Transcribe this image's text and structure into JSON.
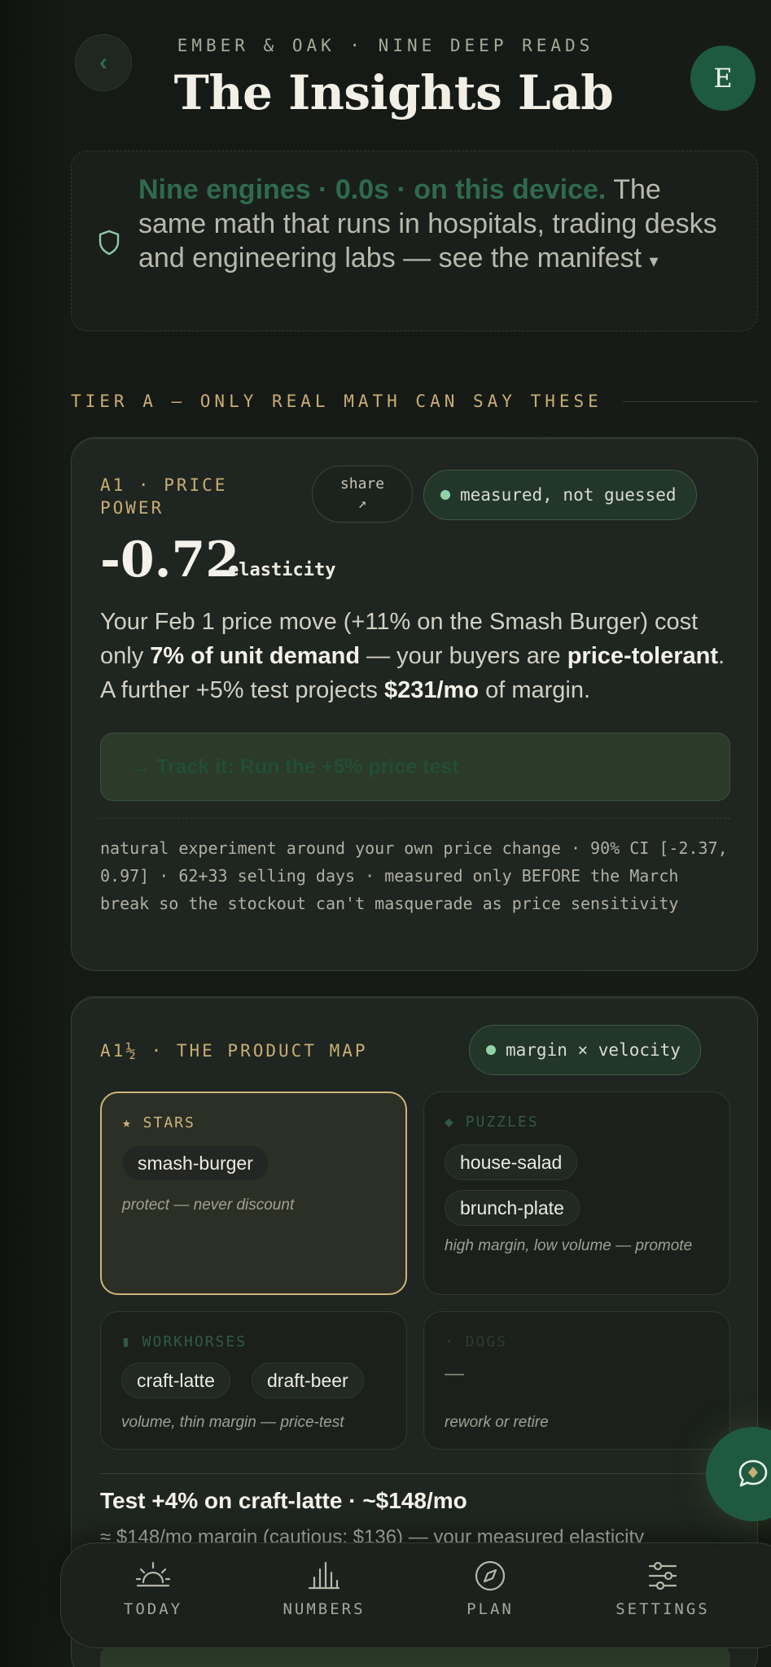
{
  "header": {
    "eyebrow": "EMBER & OAK · NINE DEEP READS",
    "title": "The Insights Lab",
    "back_icon": "chevron-left-icon",
    "avatar_initial": "E"
  },
  "manifest": {
    "highlight": "Nine engines · 0.0s · on this device.",
    "rest": " The same math that runs in hospitals, trading desks and engineering labs — see the manifest",
    "caret": "▾",
    "icon": "shield-icon"
  },
  "tier": {
    "label": "TIER A — ONLY REAL MATH CAN SAY THESE"
  },
  "price_power": {
    "tag_line1": "A1 · PRICE",
    "tag_line2": "POWER",
    "share_label": "share",
    "share_glyph": "↗",
    "badge": "measured, not guessed",
    "value": "-0.72",
    "unit": "elasticity",
    "body": {
      "p1": "Your Feb 1 price move (+11% on the Smash Burger) cost only ",
      "b1": "7% of unit demand",
      "p2": " — your buyers are ",
      "b2": "price-tolerant",
      "p3": ". A further +5% test projects ",
      "b3": "$231/mo",
      "p4": " of margin."
    },
    "cta_label": "→ Track it: Run the +5% price test",
    "fine_print": "natural experiment around your own price change · 90% CI [-2.37, 0.97] · 62+33 selling days · measured only BEFORE the March break so the stockout can't masquerade as price sensitivity"
  },
  "product_map": {
    "tag": "A1½ · THE PRODUCT MAP",
    "badge": "margin × velocity",
    "colors": {
      "stars": "#cdb47c",
      "puzzles": "#2f5a44",
      "workhorses": "#2f5a44",
      "dogs": "#2f3a31"
    },
    "stars": {
      "title": "★ STARS",
      "items": [
        "smash-burger"
      ],
      "note": "protect — never discount"
    },
    "puzzles": {
      "title": "◆ PUZZLES",
      "items": [
        "house-salad",
        "brunch-plate"
      ],
      "note": "high margin, low volume — promote"
    },
    "workhorses": {
      "title": "▮ WORKHORSES",
      "items": [
        "craft-latte",
        "draft-beer"
      ],
      "note": "volume, thin margin — price-test"
    },
    "dogs": {
      "title": "· DOGS",
      "empty": "—",
      "note": "rework or retire"
    },
    "test_title": "Test +4% on craft-latte · ~$148/mo",
    "test_sub": "≈ $148/mo margin (cautious: $136) — your measured elasticity"
  },
  "chat_fab": {
    "icon": "chat-icon"
  },
  "nav": {
    "items": [
      {
        "label": "TODAY",
        "icon": "sunrise-icon"
      },
      {
        "label": "NUMBERS",
        "icon": "bar-chart-icon"
      },
      {
        "label": "PLAN",
        "icon": "compass-icon"
      },
      {
        "label": "SETTINGS",
        "icon": "sliders-icon"
      }
    ]
  }
}
